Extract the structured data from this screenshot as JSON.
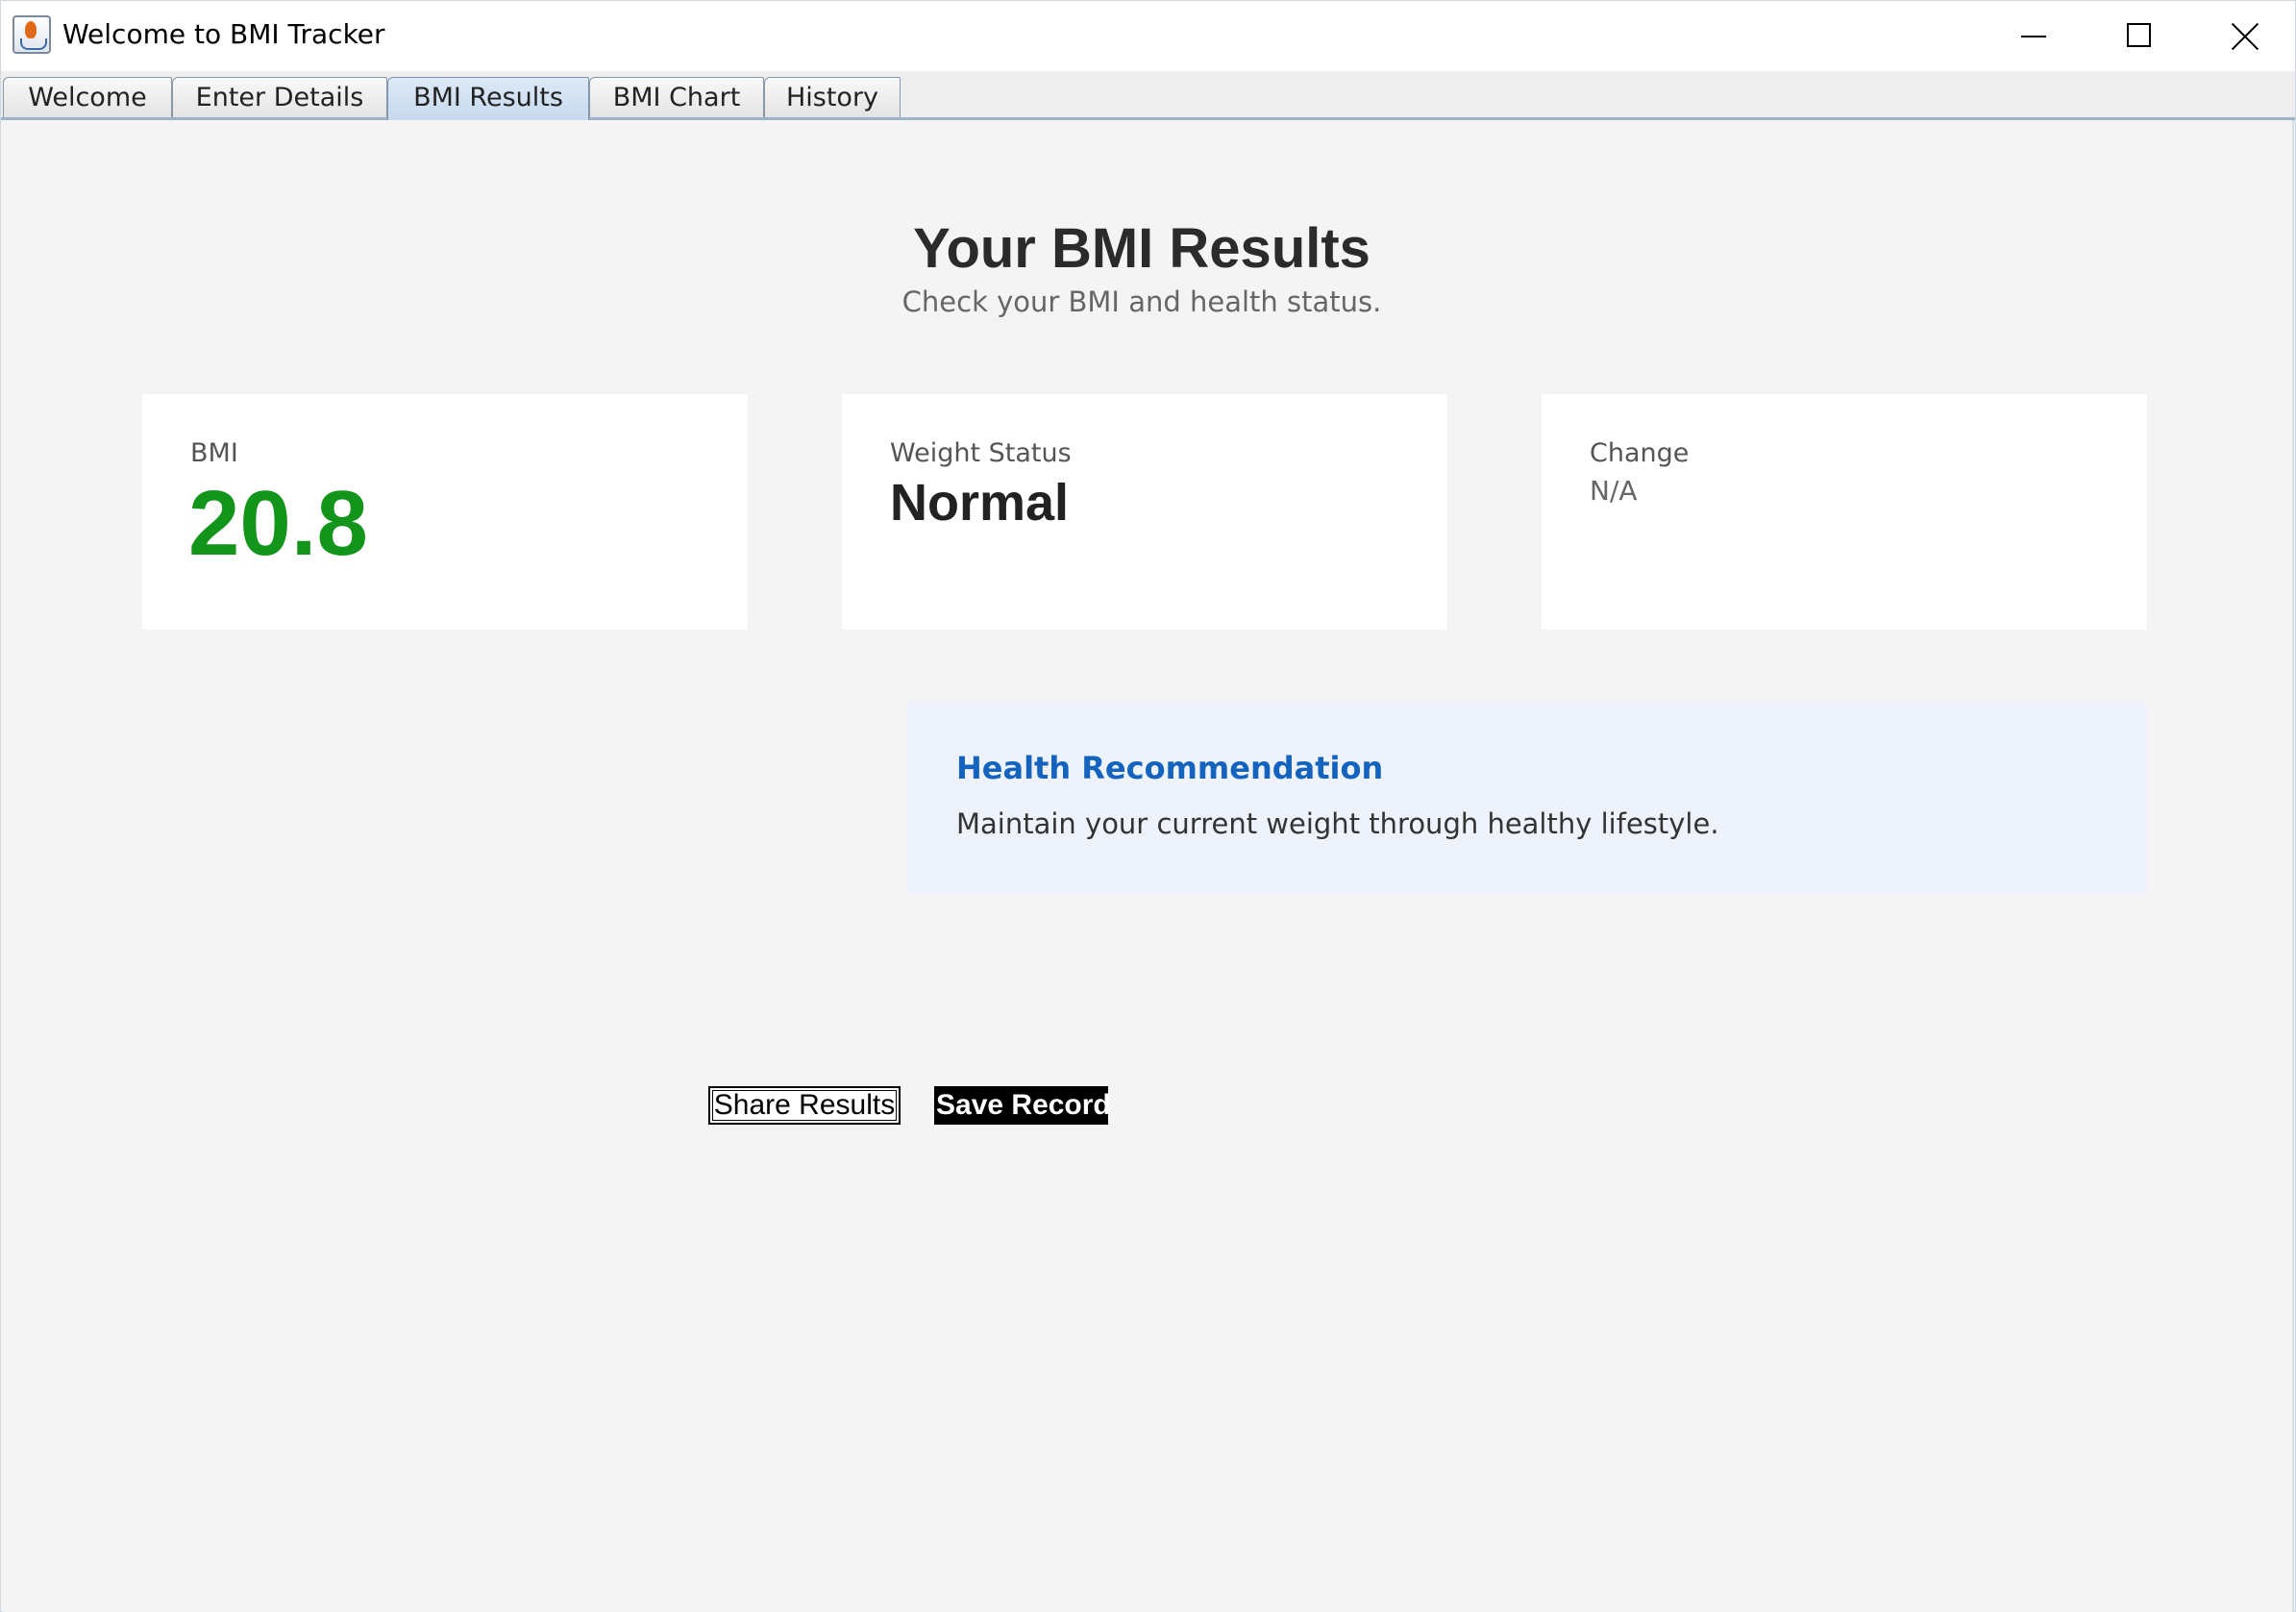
{
  "window": {
    "title": "Welcome to BMI Tracker",
    "icon": "java-cup-icon"
  },
  "tabs": [
    {
      "label": "Welcome",
      "active": false
    },
    {
      "label": "Enter Details",
      "active": false
    },
    {
      "label": "BMI Results",
      "active": true
    },
    {
      "label": "BMI Chart",
      "active": false
    },
    {
      "label": "History",
      "active": false
    }
  ],
  "page": {
    "title": "Your BMI Results",
    "subtitle": "Check your BMI and health status."
  },
  "cards": {
    "bmi": {
      "label": "BMI",
      "value": "20.8",
      "color": "#13951c"
    },
    "status": {
      "label": "Weight Status",
      "value": "Normal"
    },
    "change": {
      "label": "Change",
      "value": "N/A"
    }
  },
  "recommendation": {
    "title": "Health Recommendation",
    "text": "Maintain your current weight through healthy lifestyle.",
    "title_color": "#1463be",
    "background": "#eef3fb"
  },
  "actions": {
    "share_label": "Share Results",
    "save_label": "Save Record"
  }
}
